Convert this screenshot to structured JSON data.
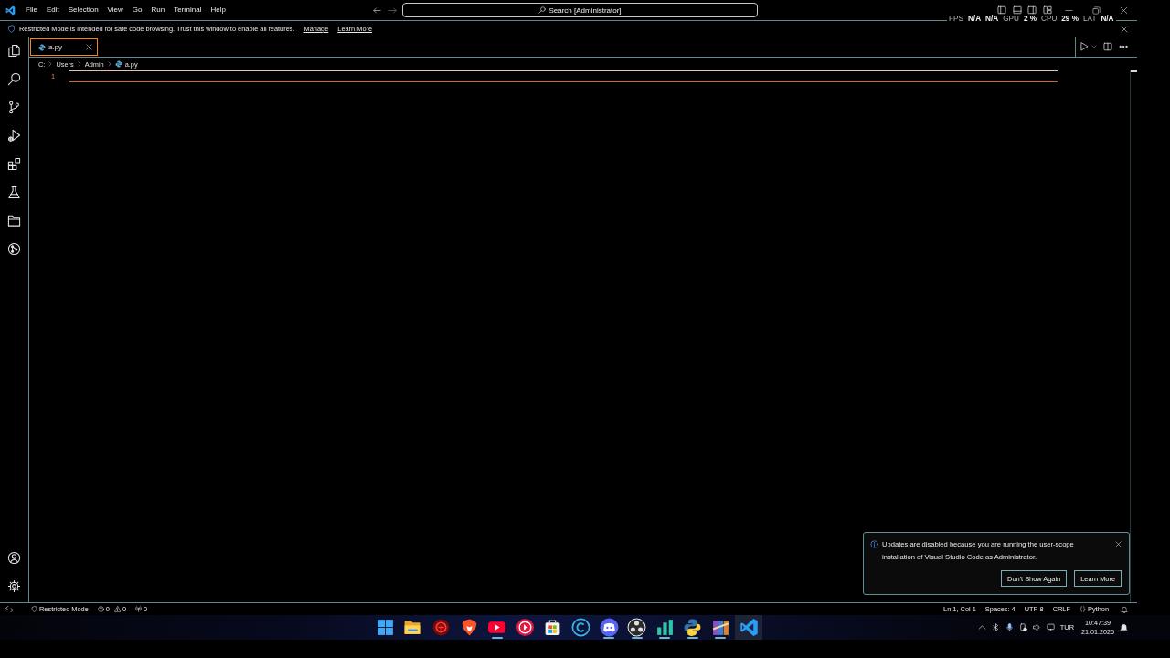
{
  "title_bar": {
    "menu": [
      "File",
      "Edit",
      "Selection",
      "View",
      "Go",
      "Run",
      "Terminal",
      "Help"
    ],
    "search": "Search [Administrator]"
  },
  "perf_overlay": [
    {
      "text": "FPS",
      "kind": "label"
    },
    {
      "text": "N/A",
      "kind": "value"
    },
    {
      "text": "N/A",
      "kind": "value"
    },
    {
      "text": "GPU",
      "kind": "label"
    },
    {
      "text": "2 %",
      "kind": "value"
    },
    {
      "text": "CPU",
      "kind": "label"
    },
    {
      "text": "29 %",
      "kind": "value"
    },
    {
      "text": "LAT",
      "kind": "label"
    },
    {
      "text": "N/A",
      "kind": "value"
    }
  ],
  "restricted_banner": {
    "message": "Restricted Mode is intended for safe code browsing. Trust this window to enable all features.",
    "links": [
      "Manage",
      "Learn More"
    ]
  },
  "tabs": [
    {
      "label": "a.py",
      "selected": true
    }
  ],
  "breadcrumb": [
    "C:",
    "Users",
    "Admin",
    "a.py"
  ],
  "editor": {
    "lines": [
      {
        "number": "1",
        "current": true
      }
    ]
  },
  "notification": {
    "message": "Updates are disabled because you are running the user-scope installation of Visual Studio Code as Administrator.",
    "buttons": [
      "Don't Show Again",
      "Learn More"
    ]
  },
  "status_bar": {
    "restricted_mode": "Restricted Mode",
    "errors": "0",
    "warnings": "0",
    "ports": "0",
    "position": "Ln 1, Col 1",
    "indentation": "Spaces: 4",
    "encoding": "UTF-8",
    "line_ending": "CRLF",
    "language": "Python"
  },
  "taskbar": {
    "apps": [
      {
        "running": false,
        "selected": false
      },
      {
        "running": false,
        "selected": false
      },
      {
        "running": false,
        "selected": false
      },
      {
        "running": false,
        "selected": false
      },
      {
        "running": true,
        "selected": false
      },
      {
        "running": false,
        "selected": false
      },
      {
        "running": false,
        "selected": false
      },
      {
        "running": false,
        "selected": false
      },
      {
        "running": true,
        "selected": false
      },
      {
        "running": true,
        "selected": false
      },
      {
        "running": true,
        "selected": false
      },
      {
        "running": true,
        "selected": false
      },
      {
        "running": true,
        "selected": false
      },
      {
        "running": false,
        "selected": true
      }
    ],
    "tray": {
      "language": "TUR",
      "time": "10:47:39",
      "date": "21.01.2025"
    }
  }
}
